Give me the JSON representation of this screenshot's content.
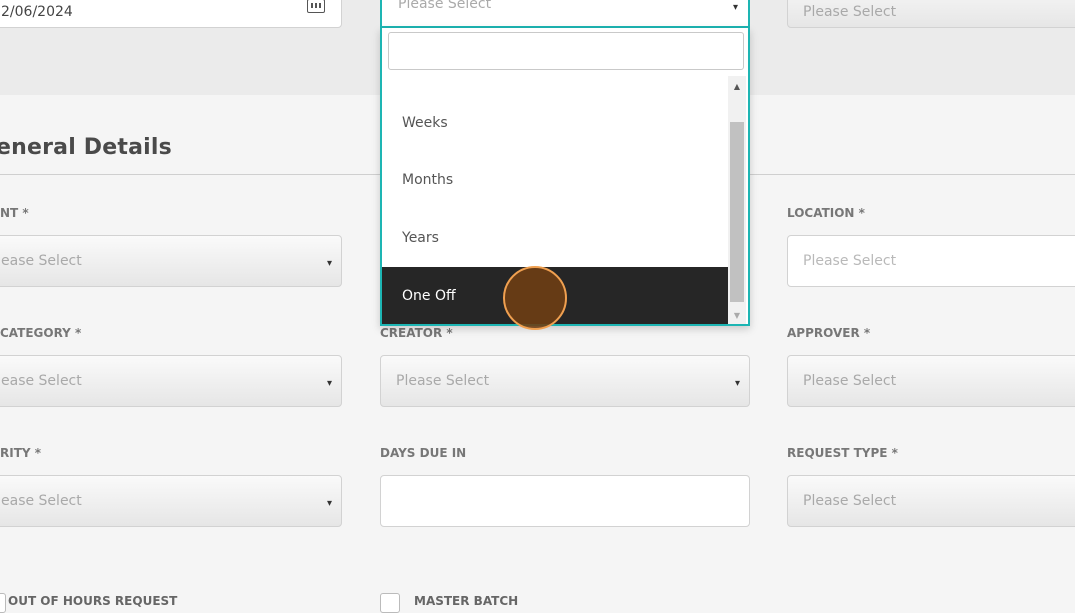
{
  "top": {
    "date_value": "2/06/2024",
    "dropdown_placeholder": "Please Select",
    "right_placeholder": "Please Select"
  },
  "section": {
    "title": "eneral Details"
  },
  "fields": {
    "client_label": "NT *",
    "client_placeholder": "ease Select",
    "location_label": "LOCATION *",
    "location_placeholder": "Please Select",
    "category_label": "CATEGORY *",
    "category_placeholder": "ease Select",
    "creator_label": "CREATOR *",
    "creator_placeholder": "Please Select",
    "approver_label": "APPROVER *",
    "approver_placeholder": "Please Select",
    "priority_label": "RITY *",
    "priority_placeholder": "ease Select",
    "days_due_label": "DAYS DUE IN",
    "days_due_value": "",
    "request_type_label": "REQUEST TYPE *",
    "request_type_placeholder": "Please Select",
    "out_of_hours_label": "OUT OF HOURS REQUEST",
    "master_batch_label": "MASTER BATCH"
  },
  "dropdown": {
    "search_value": "",
    "options": [
      "Weeks",
      "Months",
      "Years",
      "One Off"
    ],
    "selected": "One Off"
  },
  "icons": {
    "calendar": "calendar-icon",
    "caret": "▾",
    "scroll_up": "▲",
    "scroll_down": "▼"
  },
  "colors": {
    "accent": "#1db5b3",
    "selected_bg": "#262626",
    "cursor": "#f0a050"
  }
}
